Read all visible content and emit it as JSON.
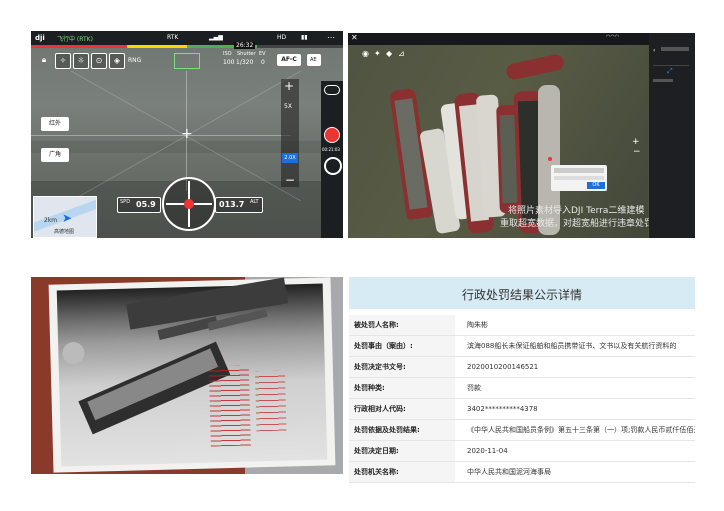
{
  "drone": {
    "brand": "dji",
    "status": "飞行中 (RTK)",
    "rtk": "RTK",
    "signal_label": "HD",
    "time": "26:32",
    "mode": "RNG",
    "iso_label": "ISO",
    "iso": "100",
    "shutter_label": "Shutter",
    "shutter": "1/320",
    "ev_label": "EV",
    "ev": "0",
    "af": "AF-C",
    "ae": "AE",
    "zoom": "5X",
    "zoom_ind": "2.0X",
    "btn_ir": "红外",
    "btn_wide": "广角",
    "map_scale": "2km",
    "map_brand": "高德地图",
    "spd_label": "SPD",
    "spd": "05.9",
    "alt_label": "ALT",
    "alt": "013.7",
    "rec_time": "00:21:03",
    "colors": {
      "accent": "#ffd700",
      "stat_green": "#7be07b"
    }
  },
  "terra": {
    "watermark_line1": "将照片素材导入DJI Terra二维建模",
    "watermark_line2": "重取超宽数据，对超宽船进行违章处罚",
    "popup_btn": "OK",
    "colors": {
      "water": "#4b4f3c",
      "hull_red": "#8b3030"
    }
  },
  "record": {
    "title": "行政处罚结果公示详情",
    "rows": [
      {
        "label": "被处罚人名称:",
        "value": "陶朱彬"
      },
      {
        "label": "处罚事由（案由）:",
        "value": "滨海088船长未保证船舶和船员携带证书、文书以及有关航行资料的"
      },
      {
        "label": "处罚决定书文号:",
        "value": "2020010200146521"
      },
      {
        "label": "处罚种类:",
        "value": "罚款"
      },
      {
        "label": "行政相对人代码:",
        "value": "3402**********4378"
      },
      {
        "label": "处罚依据及处罚结果:",
        "value": "《中华人民共和国船员条例》第五十三条第（一）项;罚款人民币贰仟伍佰元整"
      },
      {
        "label": "处罚决定日期:",
        "value": "2020-11-04"
      },
      {
        "label": "处罚机关名称:",
        "value": "中华人民共和国泥河海事局"
      }
    ]
  }
}
